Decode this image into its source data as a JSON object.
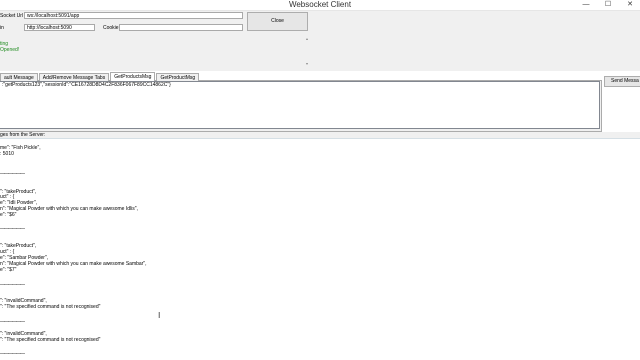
{
  "window": {
    "title": "Websocket Client",
    "minimize": "—",
    "maximize": "☐",
    "close": "✕"
  },
  "connection": {
    "url_label": "Socket Url",
    "url_value": "ws://localhost:5091/app",
    "origin_label": "in",
    "origin_value": "http://localhost:5090",
    "cookie_label": "Cookie",
    "cookie_value": "",
    "close_label": "Close",
    "status_lines": [
      "ting",
      "Opened!"
    ]
  },
  "tabs": [
    {
      "label": "ault Message"
    },
    {
      "label": "Add/Remove Message Tabs"
    },
    {
      "label": "GetProductsMsg"
    },
    {
      "label": "GetProductMsg"
    }
  ],
  "message": {
    "text": ":\"getProducts123\",\"sessionId\":\"CE16728D8D4C2F836F067F89CC14862C\"}",
    "send_label": "Send Messa"
  },
  "server_log": {
    "header": "ges from the Server:",
    "separator": "——————",
    "entries": [
      [
        "me\": \"Fish Pickle\",",
        ": 5010"
      ],
      [
        "\": \"takeProduct\",",
        "uct\" : {",
        "e\": \"Idli Powder\",",
        "n\": \"Magical Powder with which you can make awesome Idlis\",",
        "e\": \"$6\""
      ],
      [
        "\": \"takeProduct\",",
        "uct\" : {",
        "e\": \"Sambar Powder\",",
        "n\": \"Magical Powder with which you can make awesome Sambar\",",
        "e\": \"$7\""
      ],
      [
        "\": \"invalidCommand\",",
        "\": \"The specified command is not recognised\""
      ],
      [
        "\": \"invalidCommand\",",
        "\": \"The specified command is not recognised\""
      ]
    ],
    "cursor_icon": "text-cursor-icon"
  }
}
